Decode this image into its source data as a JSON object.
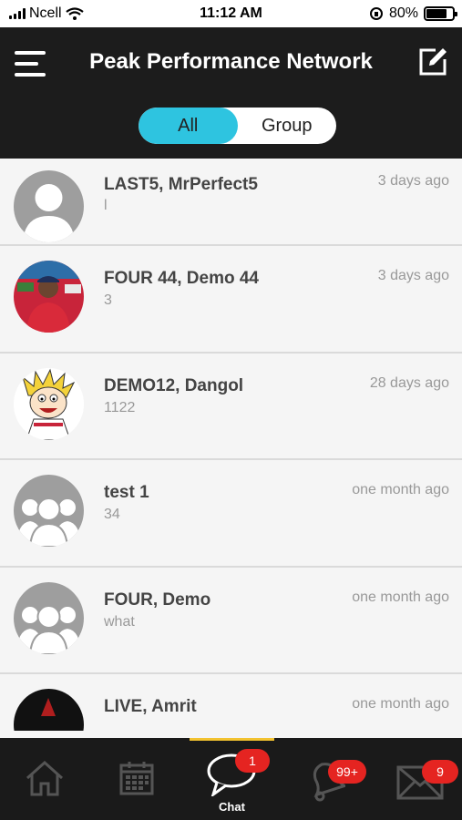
{
  "status_bar": {
    "carrier": "Ncell",
    "time": "11:12 AM",
    "battery_percent": "80%",
    "battery_level": 0.8
  },
  "header": {
    "title": "Peak Performance Network",
    "menu_icon": "hamburger-menu-icon",
    "compose_icon": "compose-icon"
  },
  "filter": {
    "options": [
      "All",
      "Group"
    ],
    "selected": "All",
    "accent": "#2ec4e0"
  },
  "chats": [
    {
      "name": "LAST5, MrPerfect5",
      "preview": "l",
      "time": "3 days ago",
      "avatar": "default-user"
    },
    {
      "name": "FOUR 44, Demo 44",
      "preview": "3",
      "time": "3 days ago",
      "avatar": "photo"
    },
    {
      "name": "DEMO12, Dangol",
      "preview": "1122",
      "time": "28 days ago",
      "avatar": "cartoon"
    },
    {
      "name": "test 1",
      "preview": "34",
      "time": "one month ago",
      "avatar": "group"
    },
    {
      "name": "FOUR, Demo",
      "preview": "what",
      "time": "one month ago",
      "avatar": "group"
    },
    {
      "name": "LIVE, Amrit",
      "preview": "",
      "time": "one month ago",
      "avatar": "dark"
    }
  ],
  "tabbar": {
    "tabs": [
      {
        "icon": "home-icon",
        "label": ""
      },
      {
        "icon": "calendar-icon",
        "label": ""
      },
      {
        "icon": "chat-icon",
        "label": "Chat",
        "badge": "1"
      },
      {
        "icon": "bell-icon",
        "label": "",
        "badge": "99+"
      },
      {
        "icon": "mail-icon",
        "label": "",
        "badge": "9"
      }
    ],
    "active": "Chat",
    "indicator_color": "#f2c230",
    "badge_color": "#e52421"
  }
}
